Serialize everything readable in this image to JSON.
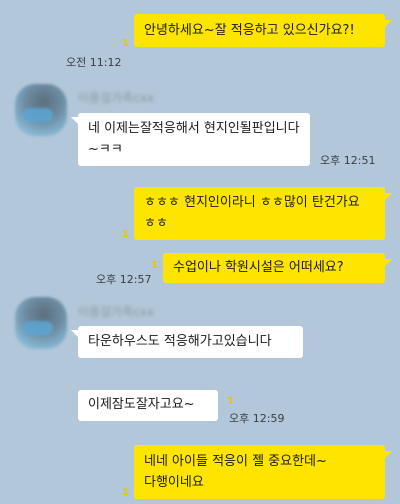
{
  "messages": [
    {
      "id": "m1",
      "side": "mine",
      "text": "안녕하세요~잘 적응하고 있으신가요?!",
      "time": "오전 11:12",
      "unread": "1"
    },
    {
      "id": "m2",
      "side": "theirs",
      "sender": "이용걸가족cxx",
      "text": "네 이제는잘적응해서 현지인될판입니다~ㅋㅋ",
      "time": "오후 12:51"
    },
    {
      "id": "m3",
      "side": "mine",
      "text": "ㅎㅎㅎ 현지인이라니 ㅎㅎ많이 탄건가요 ㅎㅎ",
      "unread": "1"
    },
    {
      "id": "m4",
      "side": "mine",
      "text": "수업이나 학원시설은 어떠세요?",
      "time": "오후 12:57",
      "unread": "1"
    },
    {
      "id": "m5",
      "side": "theirs",
      "sender": "이용걸가족cxx",
      "text": "타운하우스도 적응해가고있습니다"
    },
    {
      "id": "m6",
      "side": "theirs",
      "text": "이제잠도잘자고요~",
      "time": "오후 12:59",
      "unread": "1"
    },
    {
      "id": "m7",
      "side": "mine",
      "text": "네네 아이들 적응이 젤 중요한데~다행이네요",
      "unread": "1"
    }
  ]
}
